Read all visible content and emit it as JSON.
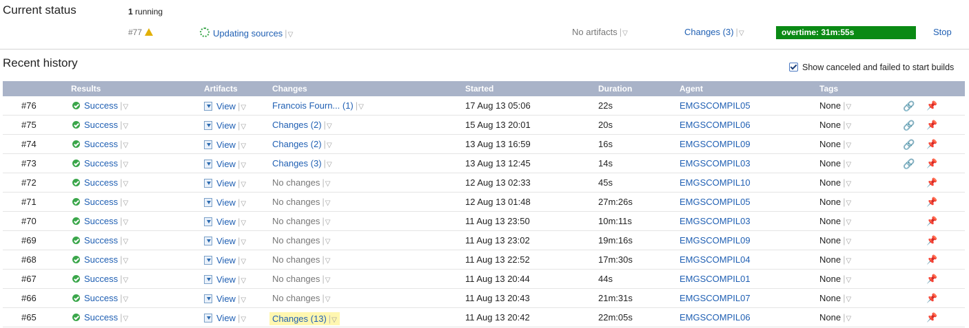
{
  "current_status": {
    "title": "Current status",
    "running_count": "1",
    "running_label": "running",
    "build": {
      "number": "#77",
      "status": "Updating sources",
      "artifacts": "No artifacts",
      "changes": "Changes (3)",
      "progress_text": "overtime: 31m:55s",
      "stop": "Stop"
    }
  },
  "recent_history": {
    "title": "Recent history",
    "show_canceled_label": "Show canceled and failed to start builds",
    "columns": [
      "Results",
      "Artifacts",
      "Changes",
      "Started",
      "Duration",
      "Agent",
      "Tags"
    ],
    "rows": [
      {
        "num": "#76",
        "result": "Success",
        "artifacts": "View",
        "changes": "Francois Fourn... (1)",
        "changes_link": true,
        "started": "17 Aug 13 05:06",
        "duration": "22s",
        "agent": "EMGSCOMPIL05",
        "tags": "None",
        "has_link": true
      },
      {
        "num": "#75",
        "result": "Success",
        "artifacts": "View",
        "changes": "Changes (2)",
        "changes_link": true,
        "started": "15 Aug 13 20:01",
        "duration": "20s",
        "agent": "EMGSCOMPIL06",
        "tags": "None",
        "has_link": true
      },
      {
        "num": "#74",
        "result": "Success",
        "artifacts": "View",
        "changes": "Changes (2)",
        "changes_link": true,
        "started": "13 Aug 13 16:59",
        "duration": "16s",
        "agent": "EMGSCOMPIL09",
        "tags": "None",
        "has_link": true
      },
      {
        "num": "#73",
        "result": "Success",
        "artifacts": "View",
        "changes": "Changes (3)",
        "changes_link": true,
        "started": "13 Aug 13 12:45",
        "duration": "14s",
        "agent": "EMGSCOMPIL03",
        "tags": "None",
        "has_link": true
      },
      {
        "num": "#72",
        "result": "Success",
        "artifacts": "View",
        "changes": "No changes",
        "changes_link": false,
        "started": "12 Aug 13 02:33",
        "duration": "45s",
        "agent": "EMGSCOMPIL10",
        "tags": "None",
        "has_link": false
      },
      {
        "num": "#71",
        "result": "Success",
        "artifacts": "View",
        "changes": "No changes",
        "changes_link": false,
        "started": "12 Aug 13 01:48",
        "duration": "27m:26s",
        "agent": "EMGSCOMPIL05",
        "tags": "None",
        "has_link": false
      },
      {
        "num": "#70",
        "result": "Success",
        "artifacts": "View",
        "changes": "No changes",
        "changes_link": false,
        "started": "11 Aug 13 23:50",
        "duration": "10m:11s",
        "agent": "EMGSCOMPIL03",
        "tags": "None",
        "has_link": false
      },
      {
        "num": "#69",
        "result": "Success",
        "artifacts": "View",
        "changes": "No changes",
        "changes_link": false,
        "started": "11 Aug 13 23:02",
        "duration": "19m:16s",
        "agent": "EMGSCOMPIL09",
        "tags": "None",
        "has_link": false
      },
      {
        "num": "#68",
        "result": "Success",
        "artifacts": "View",
        "changes": "No changes",
        "changes_link": false,
        "started": "11 Aug 13 22:52",
        "duration": "17m:30s",
        "agent": "EMGSCOMPIL04",
        "tags": "None",
        "has_link": false
      },
      {
        "num": "#67",
        "result": "Success",
        "artifacts": "View",
        "changes": "No changes",
        "changes_link": false,
        "started": "11 Aug 13 20:44",
        "duration": "44s",
        "agent": "EMGSCOMPIL01",
        "tags": "None",
        "has_link": false
      },
      {
        "num": "#66",
        "result": "Success",
        "artifacts": "View",
        "changes": "No changes",
        "changes_link": false,
        "started": "11 Aug 13 20:43",
        "duration": "21m:31s",
        "agent": "EMGSCOMPIL07",
        "tags": "None",
        "has_link": false
      },
      {
        "num": "#65",
        "result": "Success",
        "artifacts": "View",
        "changes": "Changes (13)",
        "changes_link": true,
        "highlight": true,
        "started": "11 Aug 13 20:42",
        "duration": "22m:05s",
        "agent": "EMGSCOMPIL06",
        "tags": "None",
        "has_link": false
      }
    ]
  },
  "icons": {
    "running": "spinner-icon",
    "warning": "warning-icon",
    "success": "success-check-icon",
    "artifacts": "download-icon",
    "permalink": "link-icon",
    "pin": "pin-icon",
    "dropdown": "dropdown-arrow-icon"
  },
  "colors": {
    "link": "#1f5fb3",
    "header_bg": "#a9b3c8",
    "progress_bg": "#0a8a14",
    "success": "#3aa64a",
    "highlight": "#fff7b0"
  }
}
